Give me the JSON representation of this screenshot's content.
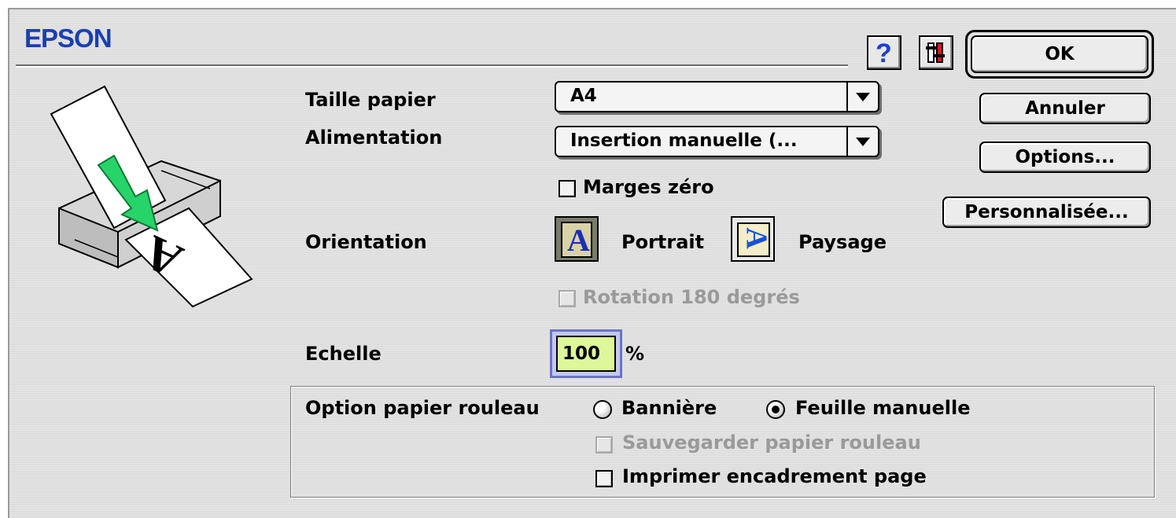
{
  "brand": "EPSON",
  "header": {
    "help_glyph": "?",
    "icons": [
      "help-icon",
      "utility-icon"
    ]
  },
  "buttons": {
    "ok": "OK",
    "cancel": "Annuler",
    "options": "Options...",
    "custom": "Personnalisée..."
  },
  "paper_size": {
    "label": "Taille papier",
    "value": "A4"
  },
  "feed": {
    "label": "Alimentation",
    "value": "Insertion manuelle (..."
  },
  "zero_margins": {
    "label": "Marges zéro",
    "checked": false
  },
  "orientation": {
    "label": "Orientation",
    "portrait": "Portrait",
    "landscape": "Paysage",
    "selected": "portrait",
    "glyph": "A"
  },
  "rotate": {
    "label": "Rotation 180 degrés",
    "checked": false,
    "enabled": false
  },
  "scale": {
    "label": "Echelle",
    "value": "100",
    "unit": "%"
  },
  "roll_paper": {
    "label": "Option papier rouleau",
    "banner": "Bannière",
    "sheet": "Feuille manuelle",
    "selected": "sheet",
    "save_roll": {
      "label": "Sauvegarder papier rouleau",
      "checked": false,
      "enabled": false
    },
    "print_frame": {
      "label": "Imprimer encadrement page",
      "checked": false
    }
  },
  "illustration_glyph": "A",
  "colors": {
    "brand": "#1a3fb3",
    "help": "#1c3fd6",
    "arrow": "#27d46a",
    "scale_bg": "#ddf79a",
    "focus": "#6b74c9"
  }
}
